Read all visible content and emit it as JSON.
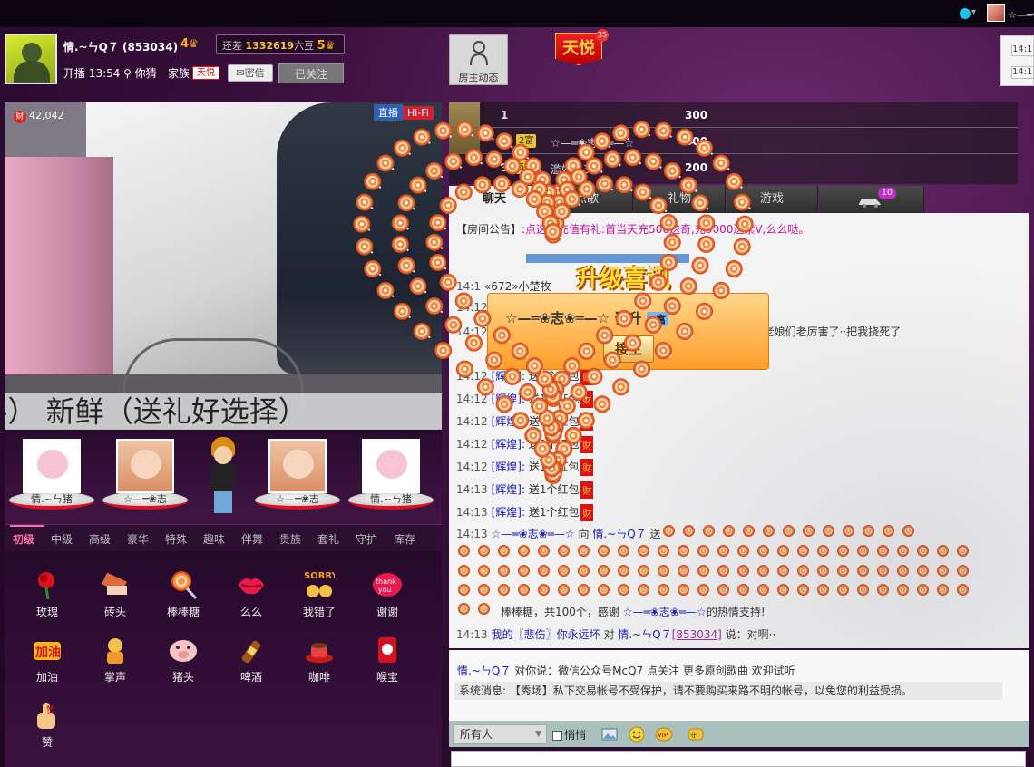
{
  "sysbar": {
    "user": "☆—═❀志❀═—☆"
  },
  "host": {
    "name": "情.~ㄣQ７ (853034)",
    "level": "4",
    "gap_label": "还差",
    "gap_value": "1332619",
    "gap_unit": "六豆",
    "next_level": "5",
    "live_time": "开播 13:54",
    "location": "你猜",
    "family_label": "家族",
    "family_badge": "天悦",
    "msg_label": "密信",
    "follow_label": "已关注"
  },
  "header": {
    "dynamic_label": "房主动态",
    "tianyue": "天悦",
    "tianyue_num": "35",
    "right_times": [
      "14:1",
      "14:1"
    ]
  },
  "video": {
    "coins": "42,042",
    "coin_icon": "财",
    "live": "直播",
    "hifi": "Hi-Fi",
    "caption": "-）  新鲜（送礼好选择）"
  },
  "fans": [
    {
      "name": "情.~ㄣ猪",
      "type": "pig"
    },
    {
      "name": "☆—═❀志",
      "type": "baby"
    },
    {
      "name": "☆—═❀志",
      "type": "baby"
    },
    {
      "name": "情.~ㄣ猪",
      "type": "pig"
    }
  ],
  "gift_tabs": [
    "初级",
    "中级",
    "高级",
    "豪华",
    "特殊",
    "趣味",
    "伴舞",
    "贵族",
    "套礼",
    "守护",
    "库存"
  ],
  "gifts": [
    {
      "label": "玫瑰",
      "icon": "rose-icon"
    },
    {
      "label": "砖头",
      "icon": "brick-icon"
    },
    {
      "label": "棒棒糖",
      "icon": "lollipop-icon"
    },
    {
      "label": "么么",
      "icon": "lips-icon"
    },
    {
      "label": "我错了",
      "icon": "sorry-icon"
    },
    {
      "label": "谢谢",
      "icon": "thanks-icon"
    },
    {
      "label": "加油",
      "icon": "cheer-icon"
    },
    {
      "label": "掌声",
      "icon": "applause-icon"
    },
    {
      "label": "猪头",
      "icon": "pig-head-icon"
    },
    {
      "label": "啤酒",
      "icon": "beer-icon"
    },
    {
      "label": "咖啡",
      "icon": "coffee-icon"
    },
    {
      "label": "喉宝",
      "icon": "throat-candy-icon"
    },
    {
      "label": "赞",
      "icon": "thumbs-up-icon"
    }
  ],
  "ranking": [
    {
      "num": "1",
      "level": "",
      "name": "",
      "score": "300"
    },
    {
      "num": "2",
      "level": "2富",
      "name": "☆—═❀志❀═—☆",
      "score": "300"
    },
    {
      "num": "3",
      "level": "5富",
      "name": "滥好人31",
      "score": "200"
    }
  ],
  "chat_tabs": [
    "聊天",
    "点歌",
    "礼物",
    "游戏",
    ""
  ],
  "chat_tab_badge": "10",
  "chat": {
    "notice_prefix": "【房间公告】:",
    "notice": "点这里充值有礼:首当天充500送奇,充3000送紫V,么么哒。",
    "line_name_frag": "«672»小楚牧",
    "line_2_frag": "老娘们老厉害了··把我挠死了",
    "repeat_time": "14:12",
    "repeat_user": "[辉煌]:",
    "repeat_msg": "送1个红包",
    "repeat_icon": "财",
    "line_last_time": "14:13",
    "gift_time": "14:13",
    "gift_from": "☆—═❀志❀═—☆",
    "gift_to_prefix": "向",
    "gift_to": "情.~ㄣQ７",
    "gift_send": "送",
    "gift_tail": "棒棒糖，共100个，感谢",
    "gift_thanks_user": "☆—═❀志❀═—☆",
    "gift_thanks_tail": "的热情支持!",
    "last_time": "14:13",
    "last_prefix": "我的",
    "last_user": "〖悲伤〗你永远坏",
    "last_to": "对",
    "last_target": "情.~ㄣQ７",
    "last_id": "[853034]",
    "last_msg": "说：对啊··"
  },
  "chat2": {
    "user": "情.~ㄣQ７",
    "msg": "对你说：微信公众号McQ7 点关注 更多原创歌曲 欢迎试听",
    "sys": "系统消息: 【秀场】私下交易帐号不受保护，请不要购买来路不明的帐号，以免您的利益受损。"
  },
  "input": {
    "to": "所有人",
    "whisper": "悄悄"
  },
  "popup": {
    "title": "升级喜讯",
    "user": "☆—═❀志❀═—☆",
    "verb": "晋升",
    "level": "8富",
    "button": "接生"
  },
  "colors": {
    "accent": "#ff6ea8",
    "link": "#1a1ab8",
    "badge_red": "#d11111"
  }
}
